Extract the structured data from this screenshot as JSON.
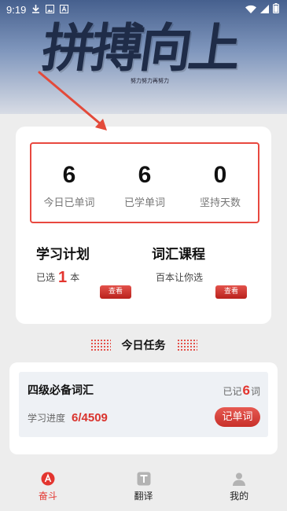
{
  "status_bar": {
    "time": "9:19"
  },
  "banner": {
    "title": "拼搏向上",
    "subtitle": "努力努力再努力"
  },
  "stats": [
    {
      "value": "6",
      "label": "今日已单词"
    },
    {
      "value": "6",
      "label": "已学单词"
    },
    {
      "value": "0",
      "label": "坚持天数"
    }
  ],
  "plan": {
    "title": "学习计划",
    "sub_prefix": "已选",
    "count": "1",
    "sub_suffix": "本",
    "button": "查看"
  },
  "course": {
    "title": "词汇课程",
    "sub": "百本让你选",
    "button": "查看"
  },
  "today_tasks": {
    "title": "今日任务"
  },
  "task": {
    "name": "四级必备词汇",
    "recorded_prefix": "已记",
    "recorded_count": "6",
    "recorded_suffix": "词",
    "progress_label": "学习进度",
    "progress_value": "6/4509",
    "record_button": "记单词"
  },
  "nav": [
    {
      "label": "奋斗",
      "icon": "fendou-icon",
      "active": true
    },
    {
      "label": "翻译",
      "icon": "translate-icon",
      "active": false
    },
    {
      "label": "我的",
      "icon": "profile-icon",
      "active": false
    }
  ],
  "colors": {
    "accent": "#e3352f",
    "background": "#ededed"
  }
}
